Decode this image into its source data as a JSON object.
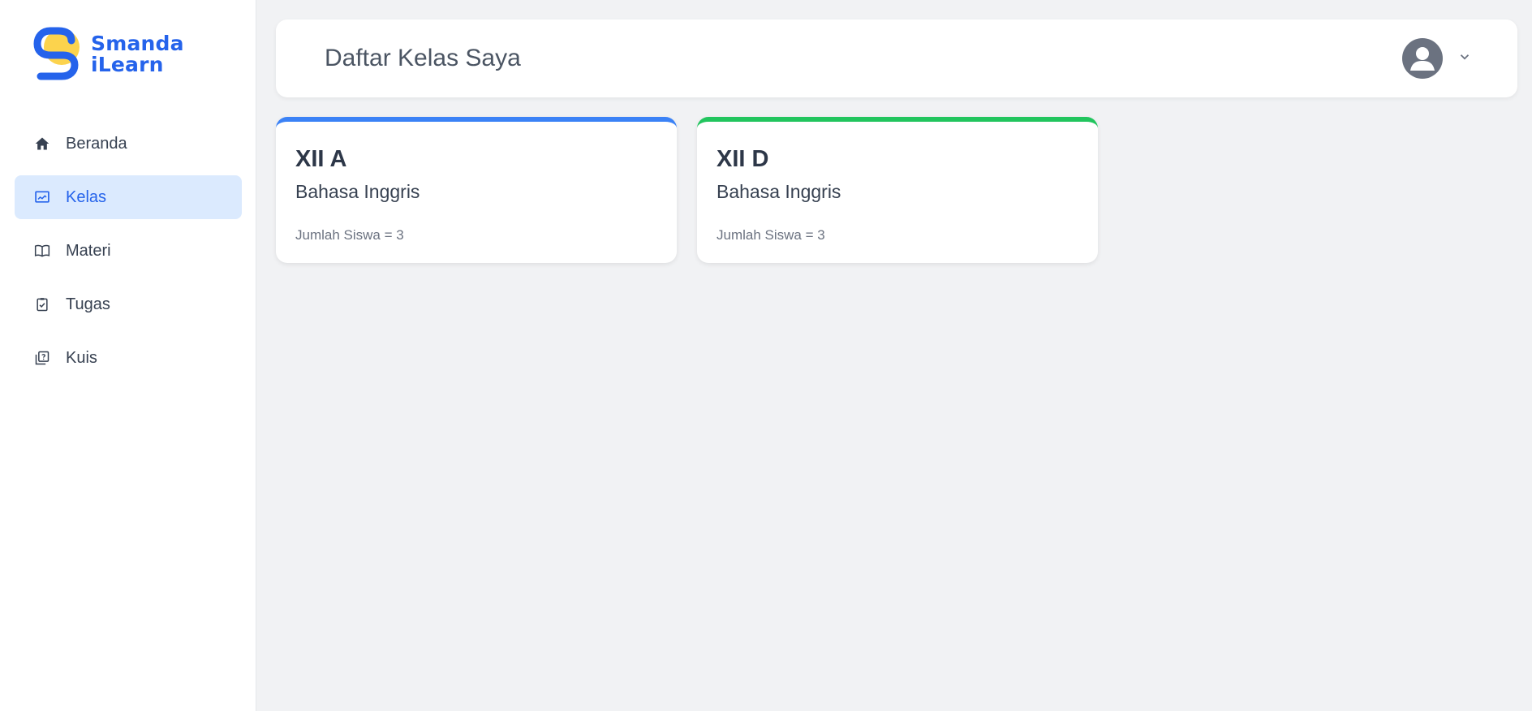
{
  "brand": {
    "line1": "Smanda",
    "line2": "iLearn",
    "color": "#2563eb",
    "accent": "#fcd34d"
  },
  "sidebar": {
    "items": [
      {
        "label": "Beranda",
        "icon": "home-icon",
        "active": false
      },
      {
        "label": "Kelas",
        "icon": "presentation-icon",
        "active": true
      },
      {
        "label": "Materi",
        "icon": "book-open-icon",
        "active": false
      },
      {
        "label": "Tugas",
        "icon": "clipboard-check-icon",
        "active": false
      },
      {
        "label": "Kuis",
        "icon": "question-square-icon",
        "active": false
      }
    ]
  },
  "header": {
    "title": "Daftar Kelas Saya",
    "user_icon": "user-avatar-icon",
    "menu_icon": "chevron-down-icon"
  },
  "classes": [
    {
      "name": "XII A",
      "subject": "Bahasa Inggris",
      "count": "Jumlah Siswa = 3",
      "color": "#3b82f6"
    },
    {
      "name": "XII D",
      "subject": "Bahasa Inggris",
      "count": "Jumlah Siswa = 3",
      "color": "#22c55e"
    }
  ]
}
